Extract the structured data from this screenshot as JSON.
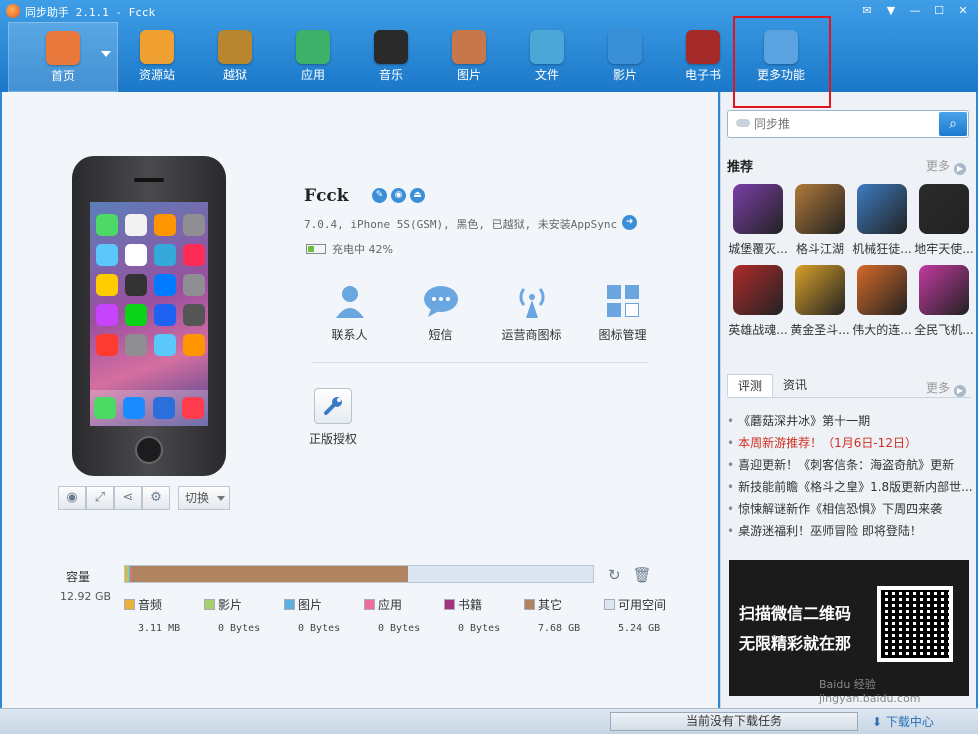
{
  "app": {
    "title": "同步助手 2.1.1 - Fcck"
  },
  "nav": [
    {
      "label": "首页",
      "icon": "home-icon",
      "color": "#e9783c"
    },
    {
      "label": "资源站",
      "icon": "shop-bag-icon",
      "color": "#f0a030"
    },
    {
      "label": "越狱",
      "icon": "pineapple-icon",
      "color": "#b8862f"
    },
    {
      "label": "应用",
      "icon": "apps-icon",
      "color": "#3fb06a"
    },
    {
      "label": "音乐",
      "icon": "music-icon",
      "color": "#2a2a2a"
    },
    {
      "label": "图片",
      "icon": "picture-icon",
      "color": "#c7784a"
    },
    {
      "label": "文件",
      "icon": "file-icon",
      "color": "#4aa7d6"
    },
    {
      "label": "影片",
      "icon": "video-icon",
      "color": "#3a90d6"
    },
    {
      "label": "电子书",
      "icon": "ebook-icon",
      "color": "#a52a2a"
    },
    {
      "label": "更多功能",
      "icon": "more-tools-icon",
      "color": "#5aa2e0"
    }
  ],
  "device": {
    "name": "Fcck",
    "info": "7.0.4, iPhone 5S(GSM), 黑色, 已越狱, 未安装AppSync",
    "battery": "充电中 42%"
  },
  "tools": [
    {
      "label": "联系人",
      "icon": "contacts-icon"
    },
    {
      "label": "短信",
      "icon": "sms-icon"
    },
    {
      "label": "运营商图标",
      "icon": "carrier-signal-icon"
    },
    {
      "label": "图标管理",
      "icon": "icon-manager-icon"
    }
  ],
  "auth": {
    "label": "正版授权"
  },
  "phone_buttons": {
    "switch_label": "切换"
  },
  "storage": {
    "label": "容量",
    "total": "12.92 GB",
    "segments_fraction": [
      0.005,
      0.003,
      0.002,
      0.002,
      0.002,
      0.59,
      0.396
    ],
    "legend": [
      {
        "name": "音频",
        "value": "3.11 MB",
        "color": "#e8b23a"
      },
      {
        "name": "影片",
        "value": "0 Bytes",
        "color": "#a6d06a"
      },
      {
        "name": "图片",
        "value": "0 Bytes",
        "color": "#5aaee0"
      },
      {
        "name": "应用",
        "value": "0 Bytes",
        "color": "#ef6f9a"
      },
      {
        "name": "书籍",
        "value": "0 Bytes",
        "color": "#a5327f"
      },
      {
        "name": "其它",
        "value": "7.68 GB",
        "color": "#b08461"
      },
      {
        "name": "可用空间",
        "value": "5.24 GB",
        "color": "#dbe6f2"
      }
    ]
  },
  "sidebar": {
    "search_placeholder": "同步推",
    "recommend_title": "推荐",
    "more_label": "更多",
    "games": [
      {
        "name": "城堡覆灭...",
        "color": "#7b3fa8"
      },
      {
        "name": "格斗江湖",
        "color": "#b07a3a"
      },
      {
        "name": "机械狂徒...",
        "color": "#3d7cc2"
      },
      {
        "name": "地牢天使...",
        "color": "#2b2b2b"
      },
      {
        "name": "英雄战魂...",
        "color": "#b02a2a"
      },
      {
        "name": "黄金圣斗...",
        "color": "#d9a12a"
      },
      {
        "name": "伟大的连...",
        "color": "#d66a2a"
      },
      {
        "name": "全民飞机...",
        "color": "#c23aa0"
      }
    ],
    "tabs": [
      "评测",
      "资讯"
    ],
    "news": [
      {
        "text": "《蘑菇深井冰》第十一期",
        "hot": false
      },
      {
        "text": "本周新游推荐！（1月6日-12日）",
        "hot": true
      },
      {
        "text": "喜迎更新！《刺客信条：海盗奇航》更新",
        "hot": false
      },
      {
        "text": "新技能前瞻《格斗之皇》1.8版更新内部世...",
        "hot": false
      },
      {
        "text": "惊悚解谜新作《相信恐惧》下周四来袭",
        "hot": false
      },
      {
        "text": "桌游迷福利！巫师冒险 即将登陆！",
        "hot": false
      }
    ],
    "ad": {
      "line1": "扫描微信二维码",
      "line2": "无限精彩就在那",
      "watermark": "Baidu 经验 jingyan.baidu.com"
    }
  },
  "statusbar": {
    "download_status": "当前没有下载任务",
    "download_center": "下载中心"
  }
}
